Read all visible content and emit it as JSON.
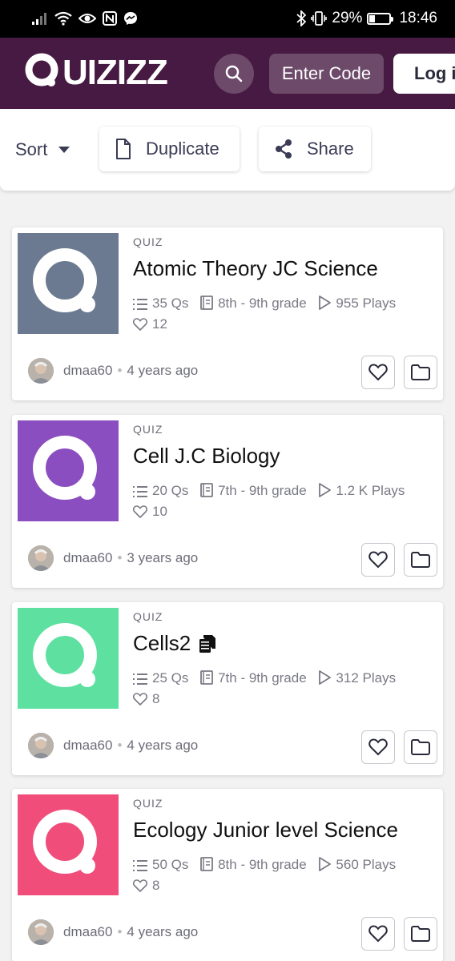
{
  "status_bar": {
    "battery": "29%",
    "time": "18:46",
    "battery_level": 0.29
  },
  "header": {
    "logo_text": "QUIZIZZ",
    "enter_code": "Enter Code",
    "login": "Log in"
  },
  "toolbar": {
    "sort": "Sort",
    "duplicate": "Duplicate",
    "share": "Share"
  },
  "quizzes": [
    {
      "kind": "QUIZ",
      "title": "Atomic Theory JC Science",
      "questions": "35 Qs",
      "grade": "8th - 9th grade",
      "plays": "955 Plays",
      "likes": "12",
      "author": "dmaa60",
      "age": "4 years ago",
      "color": "#6b7a90",
      "copy_badge": false
    },
    {
      "kind": "QUIZ",
      "title": "Cell J.C Biology",
      "questions": "20 Qs",
      "grade": "7th - 9th grade",
      "plays": "1.2 K Plays",
      "likes": "10",
      "author": "dmaa60",
      "age": "3 years ago",
      "color": "#8b4ec0",
      "copy_badge": false
    },
    {
      "kind": "QUIZ",
      "title": "Cells2",
      "questions": "25 Qs",
      "grade": "7th - 9th grade",
      "plays": "312 Plays",
      "likes": "8",
      "author": "dmaa60",
      "age": "4 years ago",
      "color": "#5ee1a0",
      "copy_badge": true
    },
    {
      "kind": "QUIZ",
      "title": "Ecology Junior level Science",
      "questions": "50 Qs",
      "grade": "8th - 9th grade",
      "plays": "560 Plays",
      "likes": "8",
      "author": "dmaa60",
      "age": "4 years ago",
      "color": "#f04d7a",
      "copy_badge": false
    }
  ]
}
